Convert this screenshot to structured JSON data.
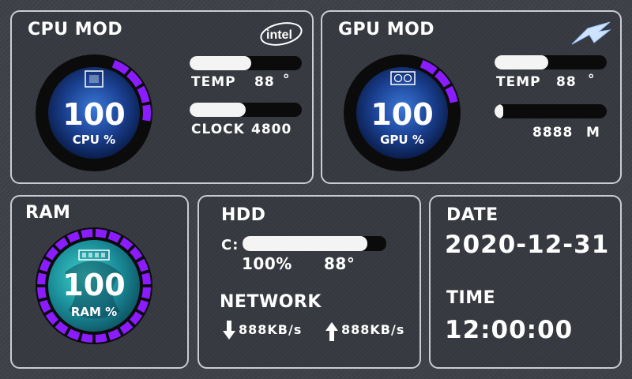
{
  "cpu": {
    "title": "CPU MOD",
    "brand": "intel",
    "gauge_value": "100",
    "gauge_label": "CPU %",
    "temp_label": "TEMP",
    "temp_value": "88",
    "temp_unit": "°",
    "temp_fraction": 0.55,
    "clock_label": "CLOCK",
    "clock_value": "4800",
    "clock_fraction": 0.5,
    "icon": "cpu-chip-icon"
  },
  "gpu": {
    "title": "GPU MOD",
    "brand_icon": "rog-logo-icon",
    "gauge_value": "100",
    "gauge_label": "GPU %",
    "temp_label": "TEMP",
    "temp_value": "88",
    "temp_unit": "°",
    "temp_fraction": 0.48,
    "mem_value": "8888",
    "mem_unit": "M",
    "mem_fraction": 0.08,
    "icon": "graphics-card-icon"
  },
  "ram": {
    "title": "RAM",
    "gauge_value": "100",
    "gauge_label": "RAM %",
    "icon": "memory-module-icon"
  },
  "hdd": {
    "title": "HDD",
    "drive_label": "C:",
    "usage_fraction": 0.87,
    "usage_text": "100%",
    "temp_text": "88°"
  },
  "network": {
    "title": "NETWORK",
    "download": "888KB/s",
    "upload": "888KB/s"
  },
  "datetime": {
    "date_label": "DATE",
    "date_value": "2020-12-31",
    "time_label": "TIME",
    "time_value": "12:00:00"
  },
  "colors": {
    "accent": "#8a1cff",
    "panel_border": "#c9ccd2",
    "gauge_ring": "#0b0b0c",
    "bar_fill": "#f4f4f4"
  }
}
